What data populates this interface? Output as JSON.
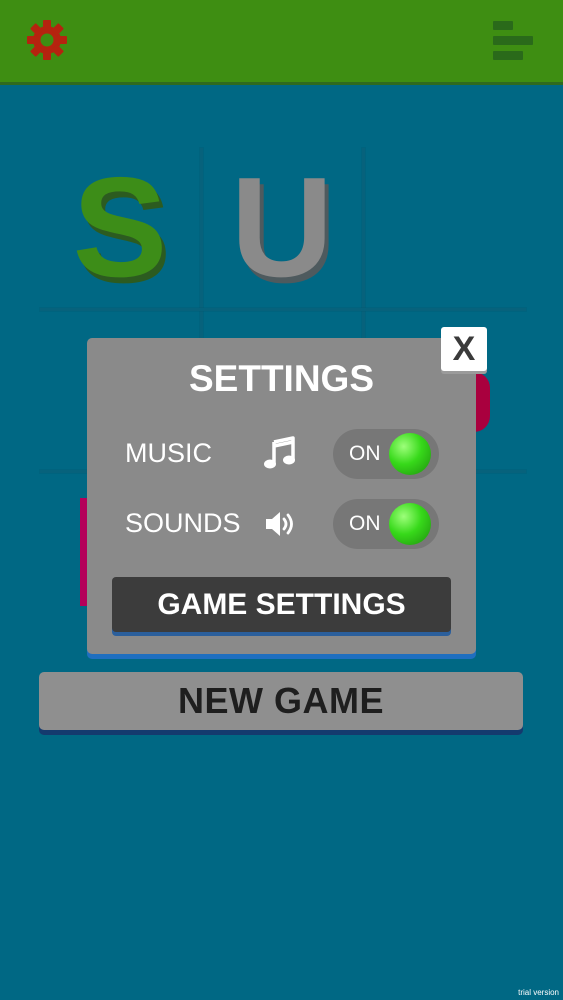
{
  "topbar": {
    "settings_icon": "gear-icon",
    "menu_icon": "leaderboard-bars-icon",
    "colors": {
      "bar": "#3e8e12",
      "gear": "#b5230f"
    }
  },
  "board": {
    "cells": [
      {
        "letter": "S",
        "color": "#3d8d18"
      },
      {
        "letter": "U",
        "color": "#8a8a8a"
      }
    ]
  },
  "new_game": {
    "label": "NEW GAME"
  },
  "settings_dialog": {
    "title": "SETTINGS",
    "close_label": "X",
    "music": {
      "label": "MUSIC",
      "icon": "music-note-icon",
      "state": "ON"
    },
    "sounds": {
      "label": "SOUNDS",
      "icon": "speaker-icon",
      "state": "ON"
    },
    "game_settings_label": "GAME SETTINGS"
  },
  "watermark": "trial version"
}
